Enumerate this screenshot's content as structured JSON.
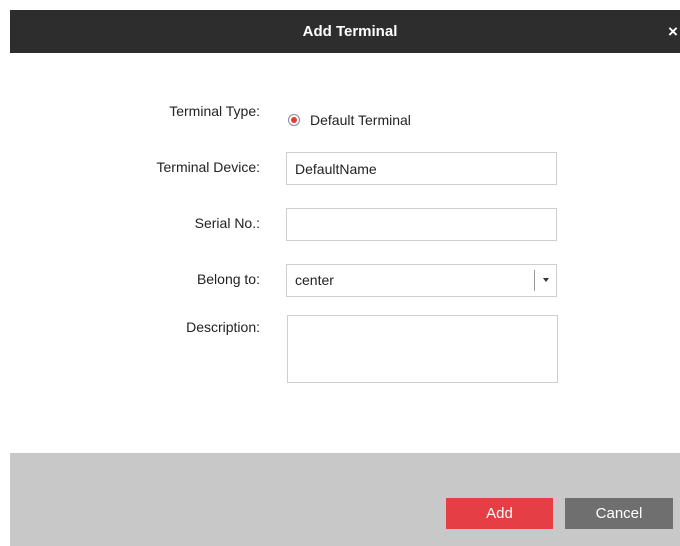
{
  "dialog": {
    "title": "Add Terminal",
    "close_glyph": "×"
  },
  "form": {
    "terminal_type_label": "Terminal Type:",
    "terminal_type_option": "Default Terminal",
    "terminal_type_selected": true,
    "terminal_device_label": "Terminal Device:",
    "terminal_device_value": "DefaultName",
    "serial_label": "Serial No.:",
    "serial_value": "",
    "belong_label": "Belong to:",
    "belong_value": "center",
    "description_label": "Description:",
    "description_value": ""
  },
  "footer": {
    "add_label": "Add",
    "cancel_label": "Cancel"
  },
  "colors": {
    "titlebar": "#2d2d2d",
    "accent": "#e53e45",
    "secondary_button": "#6f6f6f",
    "footer": "#c8c8c8"
  },
  "icons": {
    "close": "close-icon",
    "dropdown": "chevron-down-icon",
    "radio": "radio-selected-icon"
  }
}
